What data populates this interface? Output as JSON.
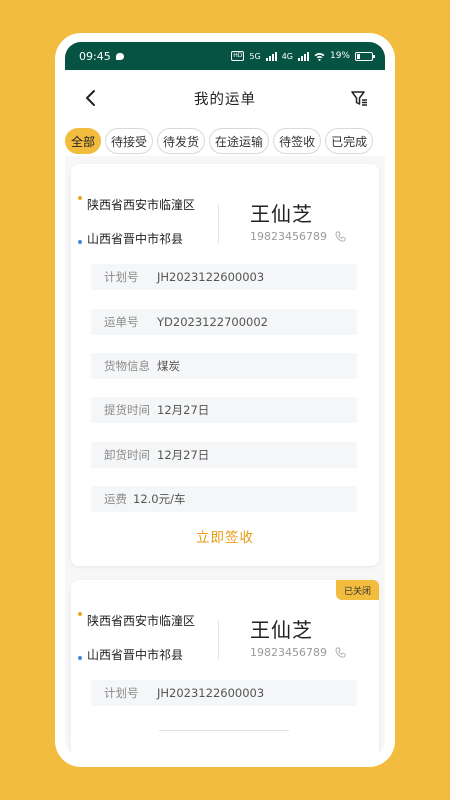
{
  "status_bar": {
    "time": "09:45",
    "network_a": "5G",
    "network_b": "4G",
    "battery_text": "19%",
    "battery_level": 0.19
  },
  "nav": {
    "title": "我的运单",
    "back_icon": "chevron-left-icon",
    "filter_icon": "filter-icon"
  },
  "tabs": [
    {
      "label": "全部",
      "active": true
    },
    {
      "label": "待接受",
      "active": false
    },
    {
      "label": "待发货",
      "active": false
    },
    {
      "label": "在途运输",
      "active": false
    },
    {
      "label": "待签收",
      "active": false
    },
    {
      "label": "已完成",
      "active": false
    }
  ],
  "colors": {
    "accent": "#F2BD3E",
    "action_text": "#E89A12",
    "status_bar": "#075343",
    "origin_dot": "#F2A516",
    "destination_dot": "#3E8BE0"
  },
  "orders": [
    {
      "from": "陕西省西安市临潼区",
      "to": "山西省晋中市祁县",
      "contact_name": "王仙芝",
      "contact_phone": "19823456789",
      "fields": [
        {
          "label": "计划号",
          "value": "JH2023122600003"
        },
        {
          "label": "运单号",
          "value": "YD2023122700002"
        },
        {
          "label": "货物信息",
          "value": "煤炭"
        },
        {
          "label": "提货时间",
          "value": "12月27日"
        },
        {
          "label": "卸货时间",
          "value": "12月27日"
        },
        {
          "label": "运费",
          "value": "12.0元/车"
        }
      ],
      "action": "立即签收"
    },
    {
      "badge": "已关闭",
      "from": "陕西省西安市临潼区",
      "to": "山西省晋中市祁县",
      "contact_name": "王仙芝",
      "contact_phone": "19823456789",
      "fields": [
        {
          "label": "计划号",
          "value": "JH2023122600003"
        }
      ]
    }
  ]
}
